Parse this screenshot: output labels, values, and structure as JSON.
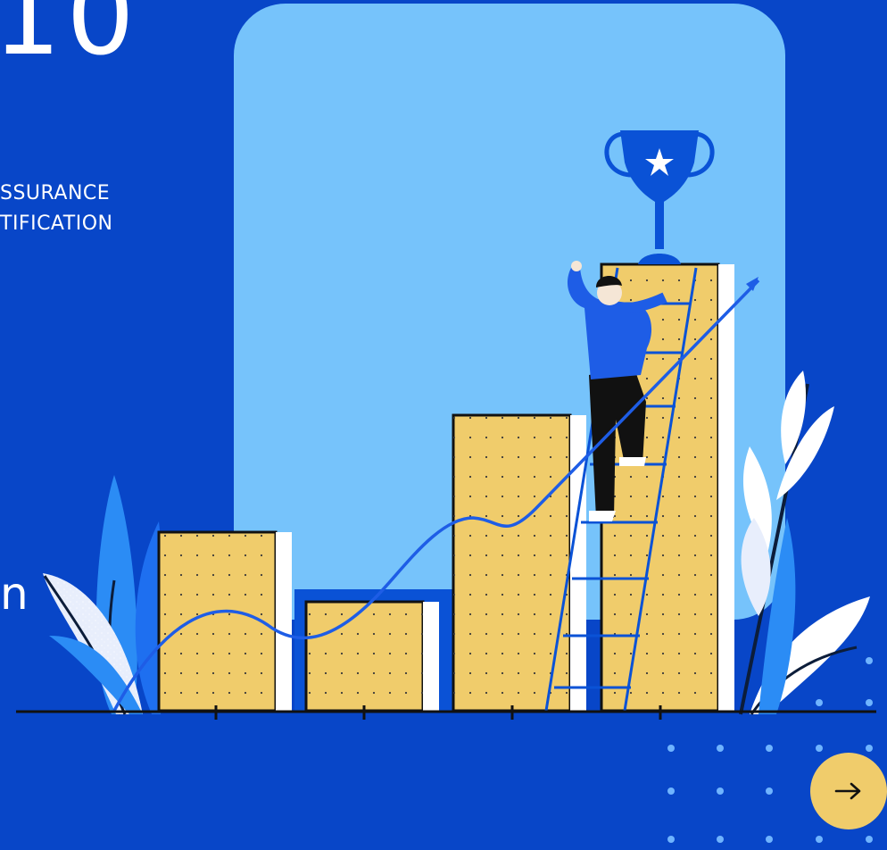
{
  "slide": {
    "title_fragment": "10",
    "subtitle_lines": [
      "SSURANCE",
      "TIFICATION"
    ],
    "side_text_fragment": "n"
  },
  "controls": {
    "next_icon": "arrow-right-icon"
  },
  "colors": {
    "background": "#0846c8",
    "panel": "#76c3fb",
    "bar_fill": "#f0cc6b",
    "button": "#f0cc6b",
    "text": "#ffffff",
    "accent_blue": "#0a52d6"
  }
}
